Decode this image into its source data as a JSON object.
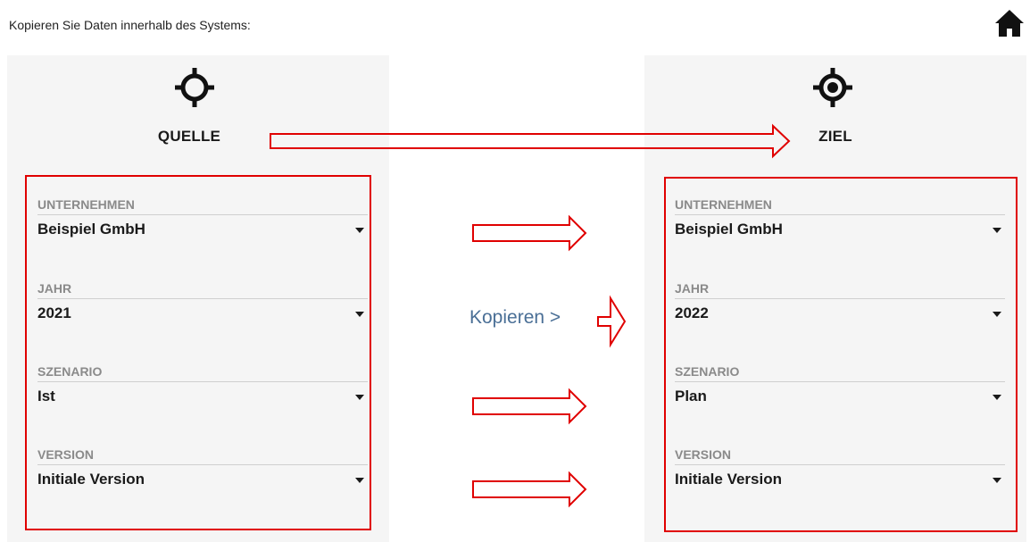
{
  "header": {
    "text": "Kopieren Sie Daten innerhalb des Systems:"
  },
  "source": {
    "title": "QUELLE",
    "fields": [
      {
        "label": "UNTERNEHMEN",
        "value": "Beispiel GmbH"
      },
      {
        "label": "JAHR",
        "value": "2021"
      },
      {
        "label": "SZENARIO",
        "value": "Ist"
      },
      {
        "label": "VERSION",
        "value": "Initiale Version"
      }
    ]
  },
  "target": {
    "title": "ZIEL",
    "fields": [
      {
        "label": "UNTERNEHMEN",
        "value": "Beispiel GmbH"
      },
      {
        "label": "JAHR",
        "value": "2022"
      },
      {
        "label": "SZENARIO",
        "value": "Plan"
      },
      {
        "label": "VERSION",
        "value": "Initiale Version"
      }
    ]
  },
  "copy_action": {
    "label": "Kopieren >"
  },
  "icons": {
    "home": "home-icon",
    "source": "crosshair-icon",
    "target": "crosshair-target-icon",
    "dropdown": "caret-down-icon"
  },
  "colors": {
    "annotation_red": "#e00000",
    "copy_link": "#4a6f96",
    "panel_bg": "#f5f5f5",
    "label_gray": "#8a8a8a"
  }
}
